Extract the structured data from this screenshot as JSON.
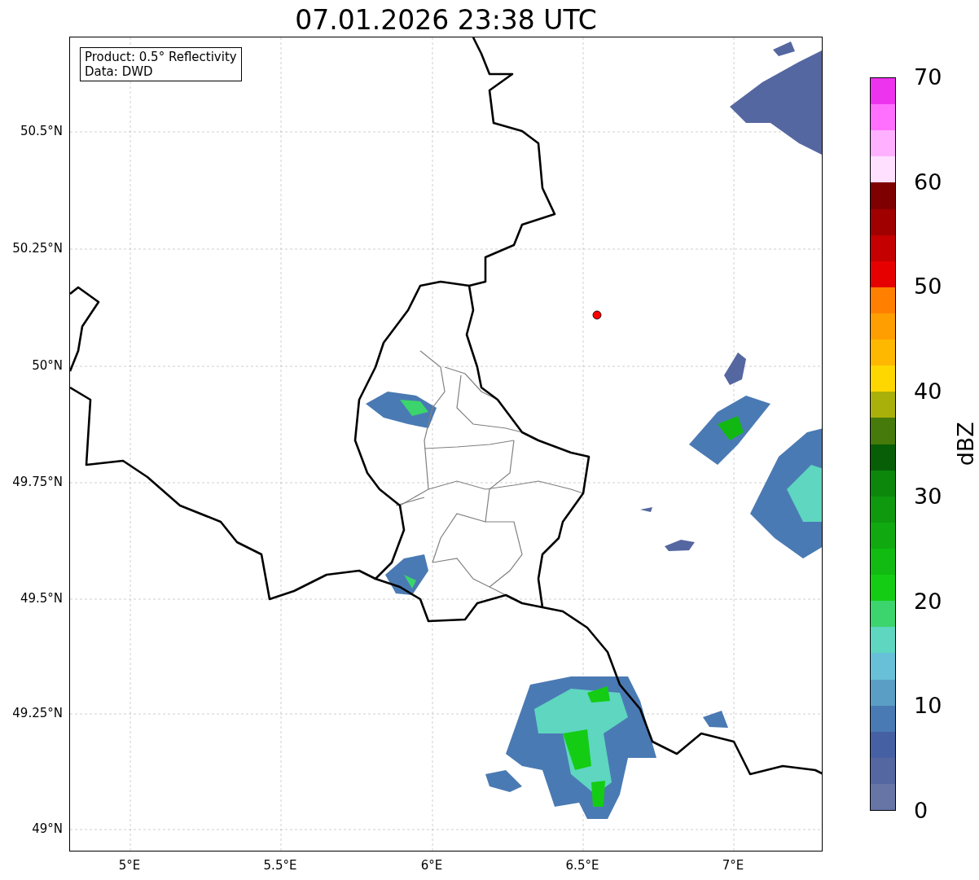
{
  "title": "07.01.2026 23:38 UTC",
  "legend": {
    "lines": [
      "Product: 0.5° Reflectivity",
      "Data: DWD"
    ]
  },
  "map": {
    "y_ticks": [
      "50.5°N",
      "50.25°N",
      "50°N",
      "49.75°N",
      "49.5°N",
      "49.25°N",
      "49°N"
    ],
    "x_ticks": [
      "5°E",
      "5.5°E",
      "6°E",
      "6.5°E",
      "7°E"
    ]
  },
  "colorbar": {
    "label": "dBZ",
    "ticks": [
      "70",
      "60",
      "50",
      "40",
      "30",
      "20",
      "10",
      "0"
    ],
    "segments": [
      {
        "color": "#ee33ee"
      },
      {
        "color": "#ff70ff"
      },
      {
        "color": "#ffb0ff"
      },
      {
        "color": "#ffe0ff"
      },
      {
        "color": "#7f0000"
      },
      {
        "color": "#a00000"
      },
      {
        "color": "#c40000"
      },
      {
        "color": "#e60000"
      },
      {
        "color": "#ff8000"
      },
      {
        "color": "#ff9e00"
      },
      {
        "color": "#ffb800"
      },
      {
        "color": "#ffd700"
      },
      {
        "color": "#aab00a"
      },
      {
        "color": "#467a0a"
      },
      {
        "color": "#075e07"
      },
      {
        "color": "#0c870c"
      },
      {
        "color": "#0e990e"
      },
      {
        "color": "#10aa10"
      },
      {
        "color": "#11bb11"
      },
      {
        "color": "#14cc14"
      },
      {
        "color": "#3cd46c"
      },
      {
        "color": "#5ed6c0"
      },
      {
        "color": "#68c0d8"
      },
      {
        "color": "#5a9ec5"
      },
      {
        "color": "#4a7ab3"
      },
      {
        "color": "#4560a3"
      },
      {
        "color": "#5567a0"
      },
      {
        "color": "#6675a6"
      }
    ]
  }
}
